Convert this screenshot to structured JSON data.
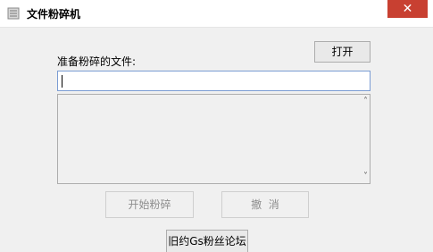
{
  "window": {
    "title": "文件粉碎机",
    "close_glyph": "✕"
  },
  "main": {
    "open_label": "打开",
    "file_label": "准备粉碎的文件:",
    "file_input_value": "",
    "start_label": "开始粉碎",
    "cancel_label": "撤  消",
    "forum_label": "旧约Gs粉丝论坛",
    "scroll_up_glyph": "˄",
    "scroll_down_glyph": "˅"
  },
  "colors": {
    "close_button": "#c84031",
    "input_border": "#7a9cd3",
    "window_bg": "#f0f0f0"
  }
}
